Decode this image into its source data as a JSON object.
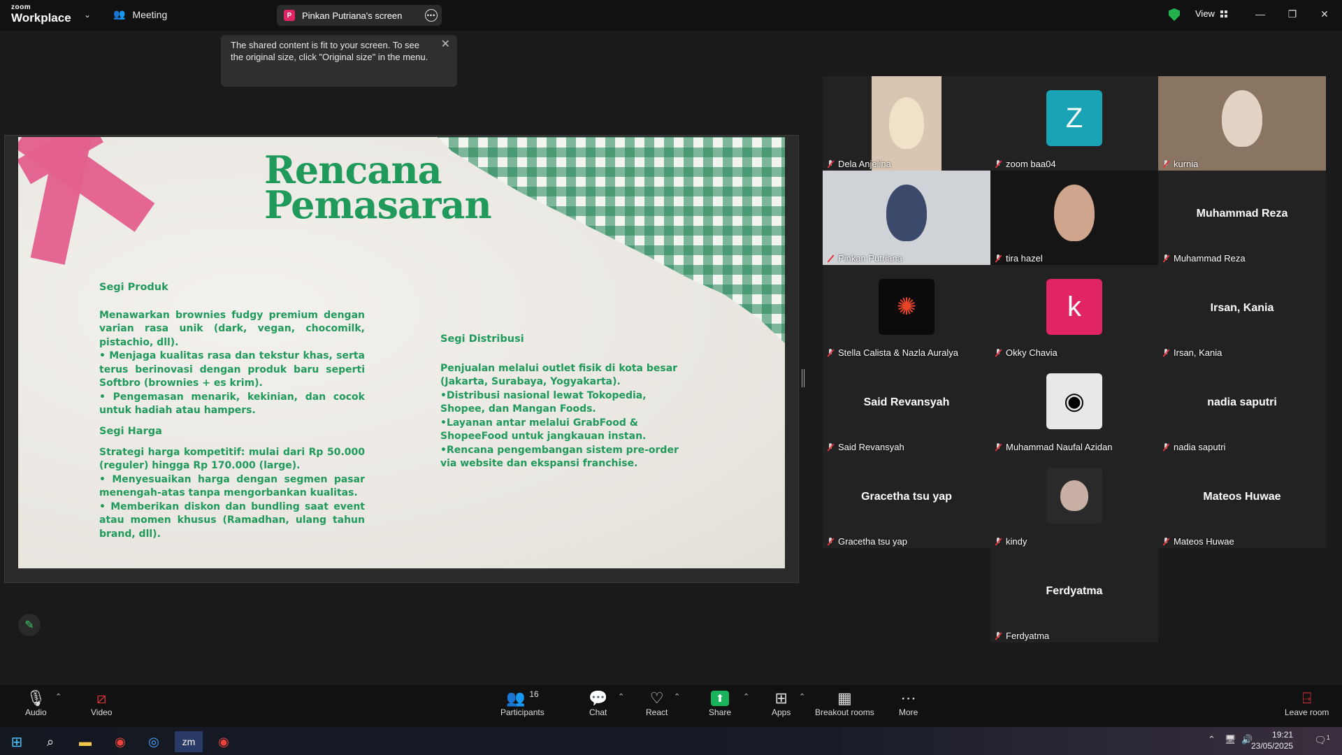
{
  "app": {
    "logo_top": "zoom",
    "logo_bottom": "Workplace",
    "meeting_label": "Meeting",
    "share_tab_badge": "P",
    "share_tab_label": "Pinkan Putriana's screen",
    "view_label": "View",
    "accent_color": "#2dc55a"
  },
  "toast": {
    "text": "The shared content is fit to your screen. To see the original size, click \"Original size\" in the menu."
  },
  "slide": {
    "title_line1": "Rencana",
    "title_line2": "Pemasaran",
    "segi_produk_heading": "Segi Produk",
    "segi_produk_body": [
      "Menawarkan brownies fudgy premium dengan varian rasa unik (dark, vegan, chocomilk, pistachio, dll).",
      "• Menjaga kualitas rasa dan tekstur khas, serta terus berinovasi dengan produk baru seperti Softbro (brownies + es krim).",
      "• Pengemasan menarik, kekinian, dan cocok untuk hadiah atau hampers."
    ],
    "segi_harga_heading": "Segi Harga",
    "segi_harga_body": [
      "Strategi harga kompetitif: mulai dari Rp 50.000 (reguler) hingga Rp 170.000 (large).",
      "• Menyesuaikan harga dengan segmen pasar menengah-atas tanpa mengorbankan kualitas.",
      "• Memberikan diskon dan bundling saat event atau momen khusus (Ramadhan, ulang tahun brand, dll)."
    ],
    "segi_distribusi_heading": "Segi Distribusi",
    "segi_distribusi_body": [
      "Penjualan melalui outlet fisik di kota besar (Jakarta, Surabaya, Yogyakarta).",
      "•Distribusi nasional lewat Tokopedia, Shopee, dan Mangan Foods.",
      "•Layanan antar melalui GrabFood & ShopeeFood untuk jangkauan instan.",
      "•Rencana pengembangan sistem pre-order via website dan ekspansi franchise."
    ]
  },
  "participants": [
    {
      "name": "Dela Anjelina",
      "display": "",
      "kind": "photo"
    },
    {
      "name": "zoom baa04",
      "display": "Z",
      "kind": "letter",
      "color": "#1aa3b5"
    },
    {
      "name": "kurnia",
      "display": "",
      "kind": "photo"
    },
    {
      "name": "Pinkan Putriana",
      "display": "",
      "kind": "photo"
    },
    {
      "name": "tira hazel",
      "display": "",
      "kind": "photo"
    },
    {
      "name": "Muhammad Reza",
      "display": "Muhammad Reza",
      "kind": "text"
    },
    {
      "name": "Stella Calista & Nazla Auralya",
      "display": "",
      "kind": "logo"
    },
    {
      "name": "Okky Chavia",
      "display": "k",
      "kind": "letter",
      "color": "#e02464"
    },
    {
      "name": "Irsan, Kania",
      "display": "Irsan, Kania",
      "kind": "text"
    },
    {
      "name": "Said Revansyah",
      "display": "Said Revansyah",
      "kind": "text"
    },
    {
      "name": "Muhammad Naufal Azidan",
      "display": "",
      "kind": "art"
    },
    {
      "name": "nadia saputri",
      "display": "nadia saputri",
      "kind": "text"
    },
    {
      "name": "Gracetha tsu yap",
      "display": "Gracetha tsu yap",
      "kind": "text"
    },
    {
      "name": "kindy",
      "display": "",
      "kind": "photo"
    },
    {
      "name": "Mateos Huwae",
      "display": "Mateos Huwae",
      "kind": "text"
    },
    {
      "name": "Ferdyatma",
      "display": "Ferdyatma",
      "kind": "text"
    }
  ],
  "toolbar": {
    "audio": "Audio",
    "video": "Video",
    "participants": "Participants",
    "participants_count": "16",
    "chat": "Chat",
    "react": "React",
    "share": "Share",
    "apps": "Apps",
    "breakout": "Breakout rooms",
    "more": "More",
    "leave": "Leave room"
  },
  "taskbar": {
    "time": "19:21",
    "date": "23/05/2025",
    "notifications": "1"
  }
}
